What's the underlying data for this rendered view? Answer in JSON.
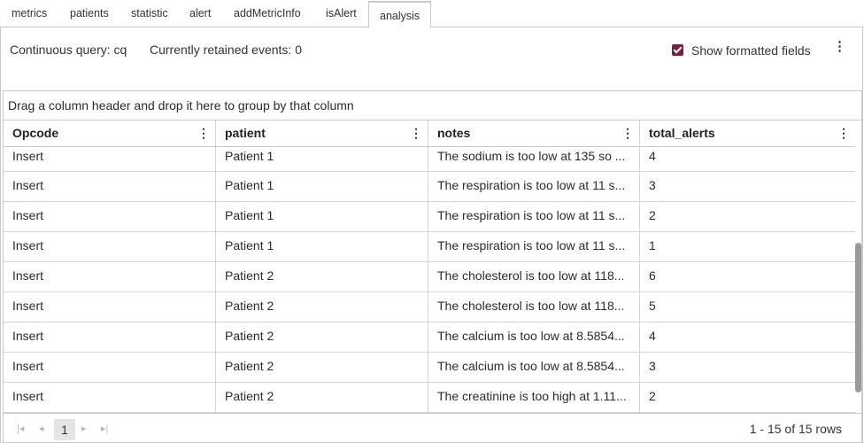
{
  "tabs": [
    {
      "label": "metrics"
    },
    {
      "label": "patients"
    },
    {
      "label": "statistic"
    },
    {
      "label": "alert"
    },
    {
      "label": "addMetricInfo"
    },
    {
      "label": "isAlert"
    },
    {
      "label": "analysis",
      "active": true
    }
  ],
  "toolbar": {
    "continuous_query": "Continuous query: cq",
    "retained_events": "Currently retained events: 0",
    "show_formatted_label": "Show formatted fields",
    "show_formatted_checked": true,
    "menu_icon": "kebab-icon"
  },
  "grid": {
    "group_hint": "Drag a column header and drop it here to group by that column",
    "columns": [
      "Opcode",
      "patient",
      "notes",
      "total_alerts"
    ],
    "rows": [
      [
        "Insert",
        "Patient 1",
        "The sodium is too low at 135 so ...",
        "4"
      ],
      [
        "Insert",
        "Patient 1",
        "The respiration is too low at 11 s...",
        "3"
      ],
      [
        "Insert",
        "Patient 1",
        "The respiration is too low at 11 s...",
        "2"
      ],
      [
        "Insert",
        "Patient 1",
        "The respiration is too low at 11 s...",
        "1"
      ],
      [
        "Insert",
        "Patient 2",
        "The cholesterol is too low at 118...",
        "6"
      ],
      [
        "Insert",
        "Patient 2",
        "The cholesterol is too low at 118...",
        "5"
      ],
      [
        "Insert",
        "Patient 2",
        "The calcium is too low at 8.5854...",
        "4"
      ],
      [
        "Insert",
        "Patient 2",
        "The calcium is too low at 8.5854...",
        "3"
      ],
      [
        "Insert",
        "Patient 2",
        "The creatinine is too high at 1.11...",
        "2"
      ]
    ]
  },
  "pager": {
    "current_page": "1",
    "summary": "1 - 15 of 15 rows"
  },
  "colors": {
    "accent": "#7a1c44",
    "border": "#c9c9c9"
  }
}
